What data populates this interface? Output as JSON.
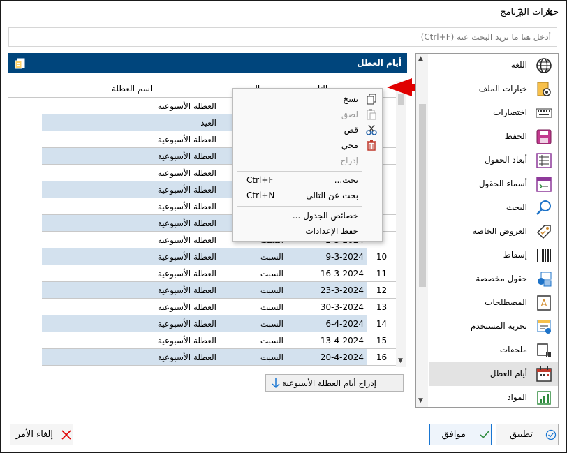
{
  "window": {
    "title": "خيارات البرنامج",
    "help_label": "?",
    "close_label": "✕"
  },
  "search": {
    "placeholder": "أدخل هنا ما تريد البحث عنه (Ctrl+F)"
  },
  "categories": [
    {
      "label": "اللغة",
      "icon": "globe-icon"
    },
    {
      "label": "خيارات الملف",
      "icon": "file-settings-icon"
    },
    {
      "label": "اختصارات",
      "icon": "keyboard-icon"
    },
    {
      "label": "الحفظ",
      "icon": "save-icon"
    },
    {
      "label": "أبعاد الحقول",
      "icon": "field-dimensions-icon"
    },
    {
      "label": "أسماء الحقول",
      "icon": "field-names-icon"
    },
    {
      "label": "البحث",
      "icon": "search-icon"
    },
    {
      "label": "العروض  الخاصة",
      "icon": "tag-icon"
    },
    {
      "label": "إسقاط",
      "icon": "barcode-icon"
    },
    {
      "label": "حقول مخصصة",
      "icon": "custom-fields-icon"
    },
    {
      "label": "المصطلحات",
      "icon": "terms-icon"
    },
    {
      "label": "تجربة المستخدم",
      "icon": "user-experience-icon"
    },
    {
      "label": "ملحقات",
      "icon": "attachments-icon"
    },
    {
      "label": "أيام العطل",
      "icon": "calendar-icon",
      "selected": true
    },
    {
      "label": "المواد",
      "icon": "materials-icon"
    }
  ],
  "section": {
    "title": "أيام العطل"
  },
  "grid": {
    "headers": {
      "date": "التاريخ",
      "day": "اليوم",
      "name": "اسم العطلة"
    },
    "rows": [
      {
        "num": "",
        "date": "",
        "day": "",
        "name": "العطلة الأسبوعية"
      },
      {
        "num": "",
        "date": "",
        "day": "",
        "name": "العيد"
      },
      {
        "num": "",
        "date": "",
        "day": "",
        "name": "العطلة الأسبوعية"
      },
      {
        "num": "",
        "date": "",
        "day": "",
        "name": "العطلة الأسبوعية"
      },
      {
        "num": "",
        "date": "",
        "day": "",
        "name": "العطلة الأسبوعية"
      },
      {
        "num": "",
        "date": "",
        "day": "",
        "name": "العطلة الأسبوعية"
      },
      {
        "num": "",
        "date": "",
        "day": "",
        "name": "العطلة الأسبوعية"
      },
      {
        "num": "",
        "date": "",
        "day": "",
        "name": "العطلة الأسبوعية"
      },
      {
        "num": "",
        "date": "2-3-2024",
        "day": "السبت",
        "name": "العطلة الأسبوعية"
      },
      {
        "num": "10",
        "date": "9-3-2024",
        "day": "السبت",
        "name": "العطلة الأسبوعية"
      },
      {
        "num": "11",
        "date": "16-3-2024",
        "day": "السبت",
        "name": "العطلة الأسبوعية"
      },
      {
        "num": "12",
        "date": "23-3-2024",
        "day": "السبت",
        "name": "العطلة الأسبوعية"
      },
      {
        "num": "13",
        "date": "30-3-2024",
        "day": "السبت",
        "name": "العطلة الأسبوعية"
      },
      {
        "num": "14",
        "date": "6-4-2024",
        "day": "السبت",
        "name": "العطلة الأسبوعية"
      },
      {
        "num": "15",
        "date": "13-4-2024",
        "day": "السبت",
        "name": "العطلة الأسبوعية"
      },
      {
        "num": "16",
        "date": "20-4-2024",
        "day": "السبت",
        "name": "العطلة الأسبوعية"
      }
    ]
  },
  "context_menu": {
    "items": [
      {
        "label": "نسخ",
        "shortcut": "",
        "icon": "copy-icon",
        "disabled": false
      },
      {
        "label": "لصق",
        "shortcut": "",
        "icon": "paste-icon",
        "disabled": true
      },
      {
        "label": "قص",
        "shortcut": "",
        "icon": "scissors-icon",
        "disabled": false
      },
      {
        "label": "محي",
        "shortcut": "",
        "icon": "trash-icon",
        "disabled": false
      },
      {
        "label": "إدراج",
        "shortcut": "",
        "icon": "",
        "disabled": true
      },
      {
        "label": "بحث...",
        "shortcut": "Ctrl+F",
        "icon": "",
        "disabled": false
      },
      {
        "label": "بحث عن التالي",
        "shortcut": "Ctrl+N",
        "icon": "",
        "disabled": false
      },
      {
        "label": "خصائص الجدول ...",
        "shortcut": "",
        "icon": "",
        "disabled": false
      },
      {
        "label": "حفظ الإعدادات",
        "shortcut": "",
        "icon": "",
        "disabled": false
      }
    ]
  },
  "insert_weekly": {
    "label": "إدراج أيام العطلة الأسبوعية"
  },
  "buttons": {
    "apply": "تطبيق",
    "ok": "موافق",
    "cancel": "إلغاء الأمر"
  },
  "colors": {
    "header_bg": "#00457c",
    "row_alt": "#d3e1ee",
    "accent": "#1976d2",
    "annotation": "#e00000"
  }
}
